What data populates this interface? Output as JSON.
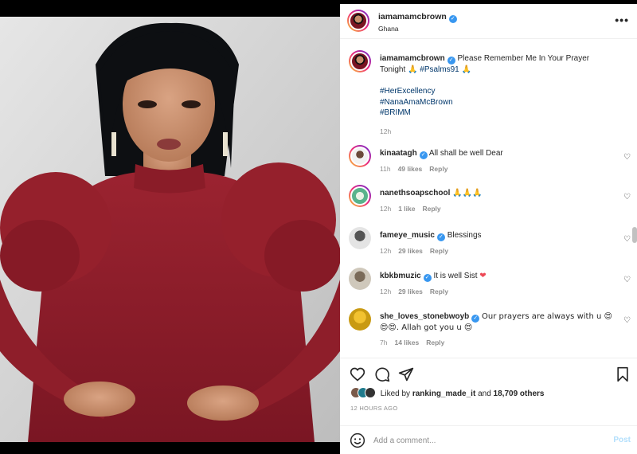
{
  "post": {
    "username": "iamamamcbrown",
    "location": "Ghana",
    "caption_username": "iamamamcbrown",
    "caption_line1": "Please Remember Me In Your Prayer",
    "caption_line2": "Tonight",
    "caption_pray1": "🙏",
    "caption_hashtag_inline": "#Psalms91",
    "caption_pray2": "🙏",
    "hashtags": [
      "#HerExcellency",
      "#NanaAmaMcBrown",
      "#BRIMM"
    ],
    "caption_time": "12h"
  },
  "comments": [
    {
      "username": "kinaatagh",
      "verified": true,
      "text": "All shall be well Dear",
      "time": "11h",
      "likes": "49 likes",
      "reply": "Reply"
    },
    {
      "username": "nanethsoapschool",
      "verified": false,
      "text": "🙏🙏🙏",
      "time": "12h",
      "likes": "1 like",
      "reply": "Reply"
    },
    {
      "username": "fameye_music",
      "verified": true,
      "text": "Blessings",
      "time": "12h",
      "likes": "29 likes",
      "reply": "Reply"
    },
    {
      "username": "kbkbmuzic",
      "verified": true,
      "text": "It is well Sist",
      "emoji": "❤",
      "time": "12h",
      "likes": "29 likes",
      "reply": "Reply"
    },
    {
      "username": "she_loves_stonebwoyb",
      "verified": true,
      "text_line1": "Our prayers are always with u 😍",
      "text_line2_emoji": "😍😍",
      "text_line2": ". Allah got you u 😍",
      "time": "7h",
      "likes": "14 likes",
      "reply": "Reply"
    }
  ],
  "footer": {
    "liked_prefix": "Liked by",
    "liked_user": "ranking_made_it",
    "liked_mid": "and",
    "liked_count": "18,709 others",
    "timestamp": "12 HOURS AGO",
    "comment_placeholder": "Add a comment...",
    "post_label": "Post"
  },
  "icons": {
    "more": "more-horizontal-icon",
    "like": "heart-outline-icon",
    "comment": "comment-bubble-icon",
    "share": "paper-plane-icon",
    "save": "bookmark-icon",
    "emoji": "smiley-icon"
  },
  "colors": {
    "verified": "#3897f0",
    "hashtag": "#00376b",
    "post_button": "#b2dffc",
    "dress": "#8d1f2b"
  }
}
